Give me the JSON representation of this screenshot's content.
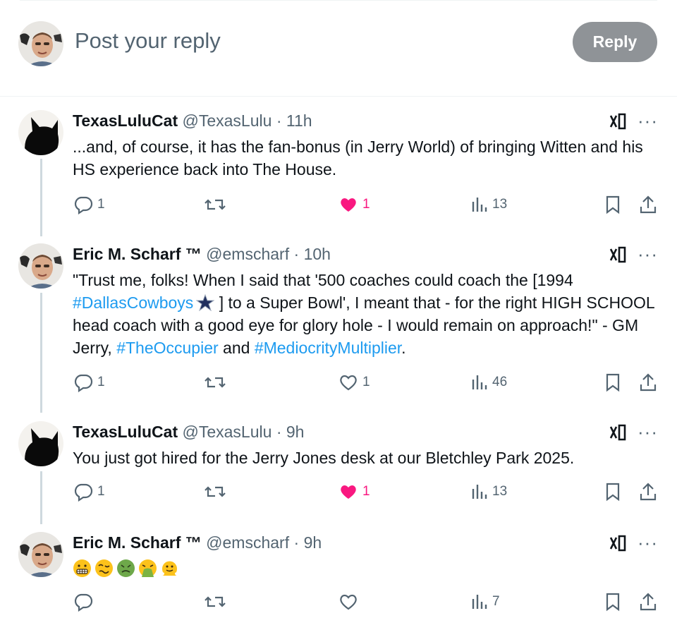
{
  "composer": {
    "placeholder": "Post your reply",
    "reply_label": "Reply"
  },
  "tweets": [
    {
      "name": "TexasLuluCat",
      "handle": "@TexasLulu",
      "time": "11h",
      "text_parts": [
        "...and, of course, it has the fan-bonus (in Jerry World) of bringing Witten and his HS experience back into The House."
      ],
      "replies": "1",
      "reposts": "",
      "likes": "1",
      "liked": true,
      "views": "13"
    },
    {
      "name": "Eric M. Scharf ™",
      "handle": "@emscharf",
      "time": "10h",
      "text_before": "\"Trust me, folks! When I said that '500 coaches could coach the [1994 ",
      "hashtag1": "#DallasCowboys",
      "text_mid": " ] to a Super Bowl', I meant that - for the right HIGH SCHOOL head coach with a good eye for glory hole - I would remain on approach!\" - GM Jerry, ",
      "hashtag2": "#TheOccupier",
      "text_and": " and ",
      "hashtag3": "#MediocrityMultiplier",
      "text_end": ".",
      "replies": "1",
      "reposts": "",
      "likes": "1",
      "liked": false,
      "views": "46"
    },
    {
      "name": "TexasLuluCat",
      "handle": "@TexasLulu",
      "time": "9h",
      "text": "You just got hired for the Jerry Jones desk at our Bletchley Park 2025.",
      "replies": "1",
      "reposts": "",
      "likes": "1",
      "liked": true,
      "views": "13"
    },
    {
      "name": "Eric M. Scharf ™",
      "handle": "@emscharf",
      "time": "9h",
      "emojis": [
        "grimacing-face",
        "woozy-face",
        "nauseated-face",
        "vomiting-face",
        "melting-face"
      ],
      "replies": "",
      "reposts": "",
      "likes": "",
      "liked": false,
      "views": "7"
    }
  ],
  "separator": "·",
  "colors": {
    "accent": "#1d9bf0",
    "like": "#f91880",
    "muted": "#536471",
    "reply_button": "#8f9397"
  }
}
